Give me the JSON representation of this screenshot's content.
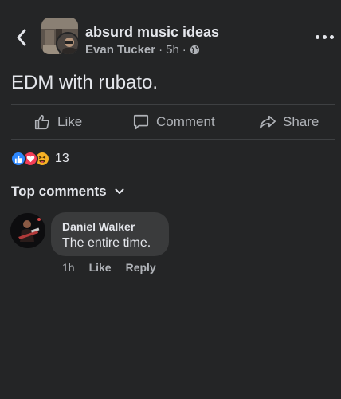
{
  "header": {
    "group_name": "absurd music ideas",
    "author": "Evan Tucker",
    "time": "5h",
    "separator": "·",
    "back_icon": "chevron-left-icon",
    "privacy_icon": "globe-icon",
    "more_icon": "more-horizontal-icon"
  },
  "post": {
    "text": "EDM with rubato."
  },
  "actions": {
    "like": "Like",
    "comment": "Comment",
    "share": "Share"
  },
  "reactions": {
    "icons": [
      "like-icon",
      "love-icon",
      "haha-icon"
    ],
    "count": "13"
  },
  "comments": {
    "sort_label": "Top comments",
    "items": [
      {
        "name": "Daniel Walker",
        "text": "The entire time.",
        "time": "1h",
        "like": "Like",
        "reply": "Reply"
      }
    ]
  },
  "colors": {
    "background": "#242526",
    "text": "#e4e6eb",
    "secondary_text": "#b0b3b8",
    "bubble": "#3a3b3c",
    "like_blue": "#2d88ff",
    "love_red": "#f33e58",
    "haha_yellow": "#f7b125"
  }
}
